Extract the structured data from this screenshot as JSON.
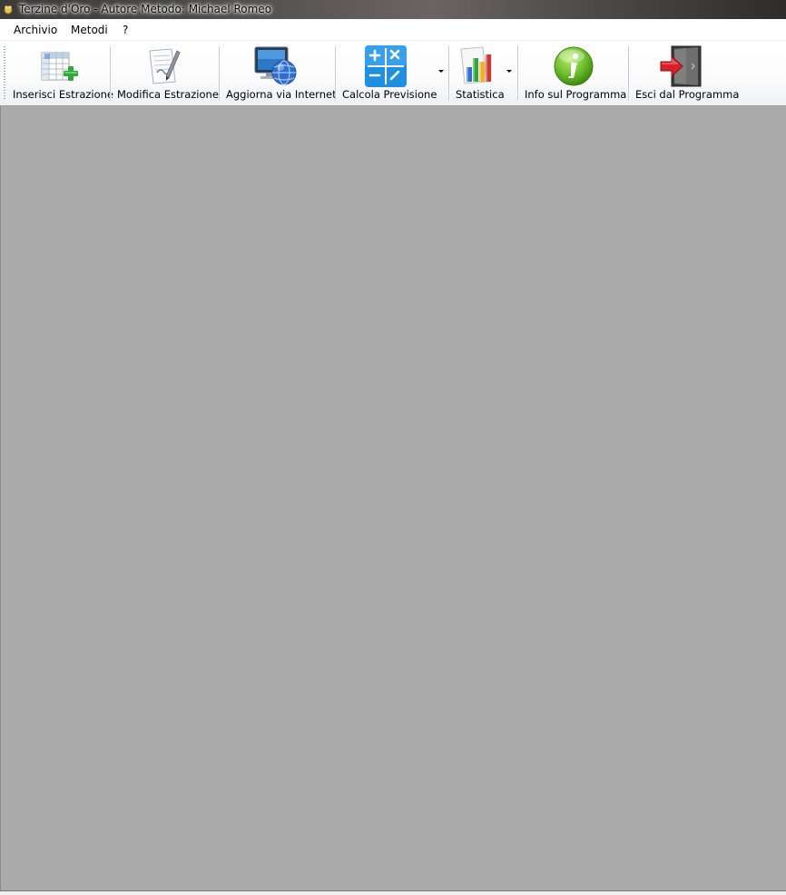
{
  "window": {
    "title": "Terzine d'Oro - Autore Metodo:  Michael Romeo",
    "icon": "app-icon"
  },
  "menu": [
    {
      "label": "Archivio"
    },
    {
      "label": "Metodi"
    },
    {
      "label": "?"
    }
  ],
  "toolbar": {
    "buttons": [
      {
        "label": "Inserisci Estrazione",
        "icon": "table-add-icon"
      },
      {
        "label": "Modifica Estrazione",
        "icon": "document-edit-icon"
      },
      {
        "label": "Aggiorna via Internet",
        "icon": "monitor-globe-icon"
      },
      {
        "label": "Calcola Previsione",
        "icon": "calculator-icon",
        "dropdown": true
      },
      {
        "label": "Statistica",
        "icon": "bar-chart-icon",
        "dropdown": true
      },
      {
        "label": "Info sul Programma",
        "icon": "info-icon"
      },
      {
        "label": "Esci dal Programma",
        "icon": "exit-door-icon"
      }
    ]
  },
  "colors": {
    "workspace": "#ababab",
    "calculator": "#1e90e0",
    "info": "#6cbf2a",
    "exit_arrow": "#d8222a"
  }
}
